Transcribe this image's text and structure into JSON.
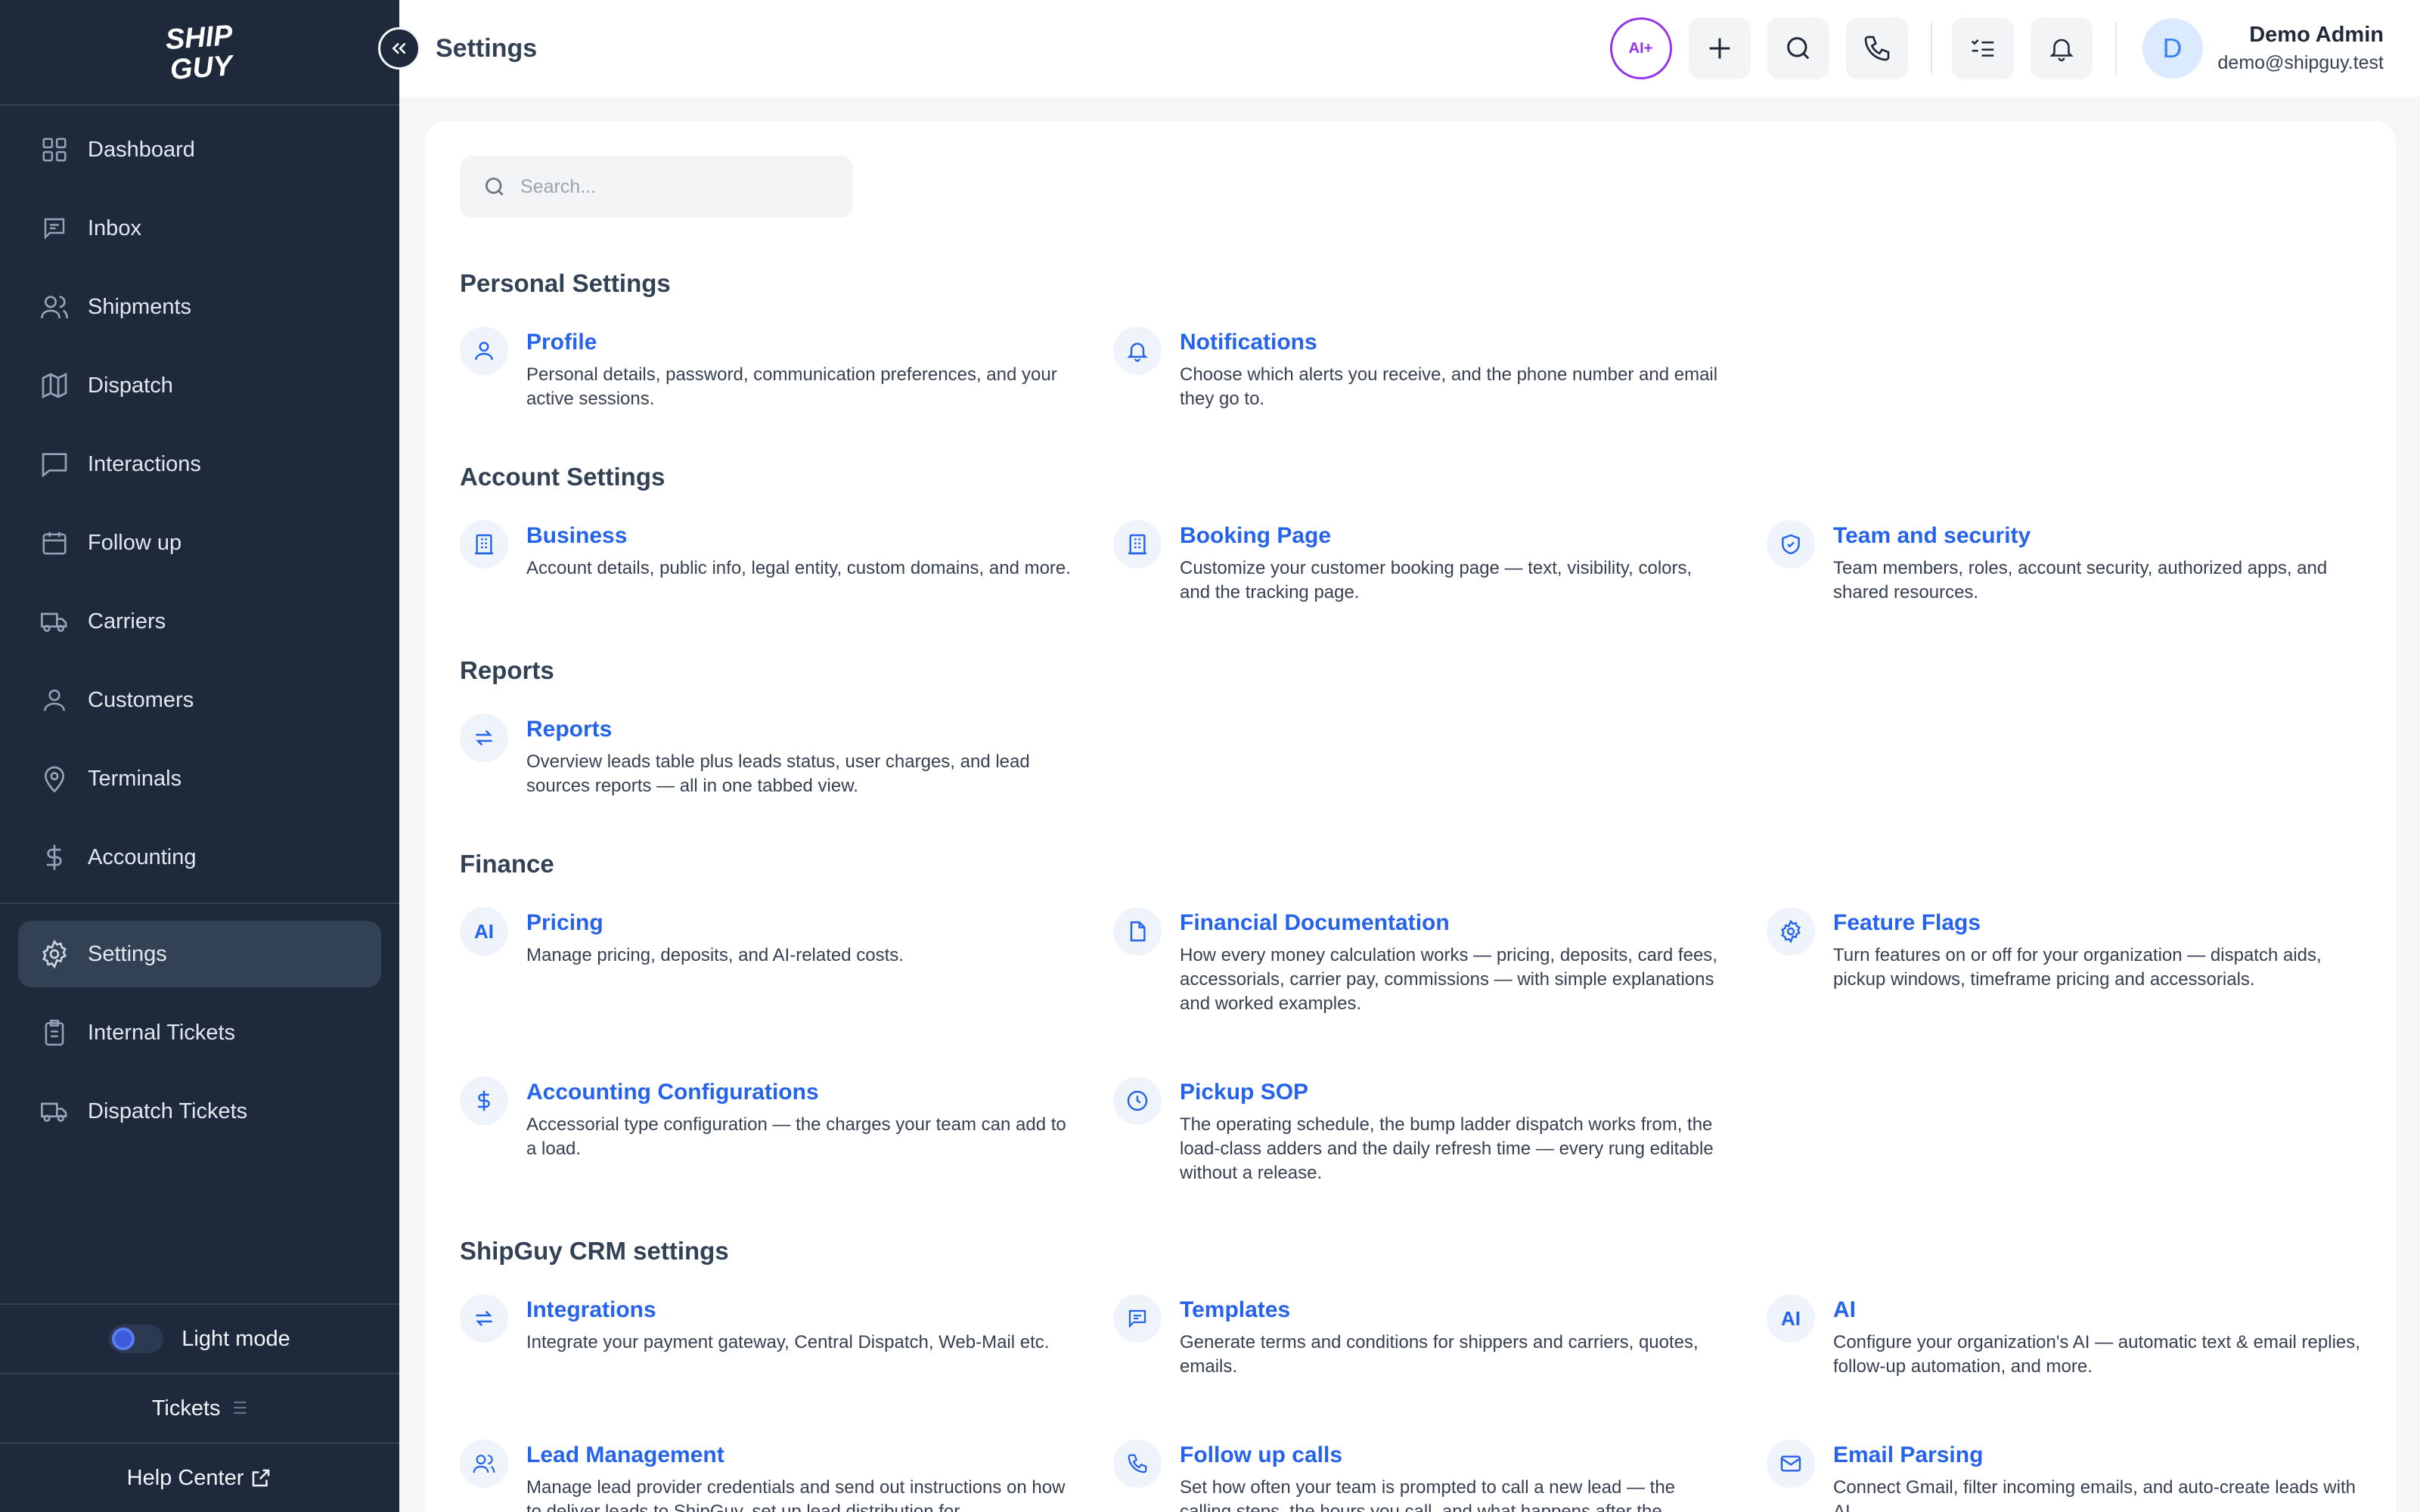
{
  "brand": {
    "logo_line1": "SHIP",
    "logo_line2": "GUY"
  },
  "sidebar": {
    "items": [
      {
        "label": "Dashboard"
      },
      {
        "label": "Inbox"
      },
      {
        "label": "Shipments"
      },
      {
        "label": "Dispatch"
      },
      {
        "label": "Interactions"
      },
      {
        "label": "Follow up"
      },
      {
        "label": "Carriers"
      },
      {
        "label": "Customers"
      },
      {
        "label": "Terminals"
      },
      {
        "label": "Accounting"
      }
    ],
    "lower_items": [
      {
        "label": "Settings",
        "active": true
      },
      {
        "label": "Internal Tickets"
      },
      {
        "label": "Dispatch Tickets"
      }
    ],
    "theme_label": "Light mode",
    "tickets_label": "Tickets",
    "help_label": "Help Center"
  },
  "header": {
    "title": "Settings",
    "ai_label": "AI+",
    "user_initial": "D",
    "user_name": "Demo Admin",
    "user_email": "demo@shipguy.test"
  },
  "search": {
    "placeholder": "Search..."
  },
  "sections": [
    {
      "title": "Personal Settings",
      "items": [
        {
          "title": "Profile",
          "desc": "Personal details, password, communication preferences, and your active sessions.",
          "icon": "user-icon"
        },
        {
          "title": "Notifications",
          "desc": "Choose which alerts you receive, and the phone number and email they go to.",
          "icon": "bell-icon"
        }
      ]
    },
    {
      "title": "Account Settings",
      "items": [
        {
          "title": "Business",
          "desc": "Account details, public info, legal entity, custom domains, and more.",
          "icon": "building-icon"
        },
        {
          "title": "Booking Page",
          "desc": "Customize your customer booking page — text, visibility, colors, and the tracking page.",
          "icon": "building-icon"
        },
        {
          "title": "Team and security",
          "desc": "Team members, roles, account security, authorized apps, and shared resources.",
          "icon": "shield-icon"
        }
      ]
    },
    {
      "title": "Reports",
      "items": [
        {
          "title": "Reports",
          "desc": "Overview leads table plus leads status, user charges, and lead sources reports — all in one tabbed view.",
          "icon": "refresh-icon"
        }
      ]
    },
    {
      "title": "Finance",
      "items": [
        {
          "title": "Pricing",
          "desc": "Manage pricing, deposits, and AI-related costs.",
          "icon": "ai-text-icon",
          "icon_text": "AI"
        },
        {
          "title": "Financial Documentation",
          "desc": "How every money calculation works — pricing, deposits, card fees, accessorials, carrier pay, commissions — with simple explanations and worked examples.",
          "icon": "document-icon"
        },
        {
          "title": "Feature Flags",
          "desc": "Turn features on or off for your organization — dispatch aids, pickup windows, timeframe pricing and accessorials.",
          "icon": "gear-icon"
        },
        {
          "title": "Accounting Configurations",
          "desc": "Accessorial type configuration — the charges your team can add to a load.",
          "icon": "dollar-icon"
        },
        {
          "title": "Pickup SOP",
          "desc": "The operating schedule, the bump ladder dispatch works from, the load-class adders and the daily refresh time — every rung editable without a release.",
          "icon": "clock-icon"
        }
      ]
    },
    {
      "title": "ShipGuy CRM settings",
      "items": [
        {
          "title": "Integrations",
          "desc": "Integrate your payment gateway, Central Dispatch, Web-Mail etc.",
          "icon": "refresh-icon"
        },
        {
          "title": "Templates",
          "desc": "Generate terms and conditions for shippers and carriers, quotes, emails.",
          "icon": "message-icon"
        },
        {
          "title": "AI",
          "desc": "Configure your organization's AI — automatic text & email replies, follow-up automation, and more.",
          "icon": "ai-text-icon",
          "icon_text": "AI"
        },
        {
          "title": "Lead Management",
          "desc": "Manage lead provider credentials and send out instructions on how to deliver leads to ShipGuy, set up lead distribution for",
          "icon": "users-icon"
        },
        {
          "title": "Follow up calls",
          "desc": "Set how often your team is prompted to call a new lead — the calling steps, the hours you call, and what happens after the",
          "icon": "phone-icon"
        },
        {
          "title": "Email Parsing",
          "desc": "Connect Gmail, filter incoming emails, and auto-create leads with AI.",
          "icon": "mail-icon"
        }
      ]
    }
  ],
  "colors": {
    "sidebar_bg": "#1e293b",
    "accent": "#2563eb",
    "ai_purple": "#9333ea"
  }
}
